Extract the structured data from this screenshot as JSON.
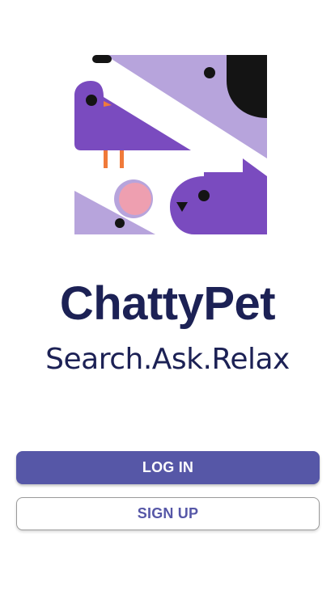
{
  "app": {
    "name": "ChattyPet",
    "tagline": "Search.Ask.Relax"
  },
  "actions": {
    "login_label": "LOG IN",
    "signup_label": "SIGN UP"
  },
  "colors": {
    "primary": "#5657a7",
    "title_text": "#1c2155",
    "purple_dark": "#7a4bbf",
    "purple_light": "#b7a4dc",
    "pink": "#ee9fb0",
    "orange": "#f07a3a",
    "black": "#141414"
  },
  "logo": {
    "icon": "pets-illustration-icon"
  }
}
